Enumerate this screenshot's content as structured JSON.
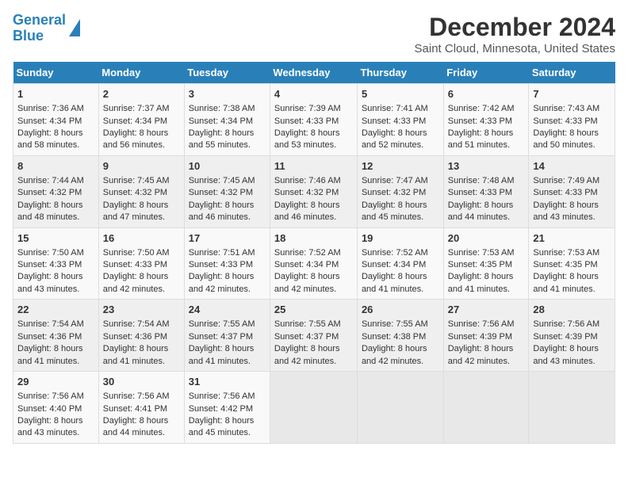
{
  "header": {
    "logo_line1": "General",
    "logo_line2": "Blue",
    "title": "December 2024",
    "subtitle": "Saint Cloud, Minnesota, United States"
  },
  "days_of_week": [
    "Sunday",
    "Monday",
    "Tuesday",
    "Wednesday",
    "Thursday",
    "Friday",
    "Saturday"
  ],
  "weeks": [
    [
      {
        "day": 1,
        "sunrise": "Sunrise: 7:36 AM",
        "sunset": "Sunset: 4:34 PM",
        "daylight": "Daylight: 8 hours and 58 minutes."
      },
      {
        "day": 2,
        "sunrise": "Sunrise: 7:37 AM",
        "sunset": "Sunset: 4:34 PM",
        "daylight": "Daylight: 8 hours and 56 minutes."
      },
      {
        "day": 3,
        "sunrise": "Sunrise: 7:38 AM",
        "sunset": "Sunset: 4:34 PM",
        "daylight": "Daylight: 8 hours and 55 minutes."
      },
      {
        "day": 4,
        "sunrise": "Sunrise: 7:39 AM",
        "sunset": "Sunset: 4:33 PM",
        "daylight": "Daylight: 8 hours and 53 minutes."
      },
      {
        "day": 5,
        "sunrise": "Sunrise: 7:41 AM",
        "sunset": "Sunset: 4:33 PM",
        "daylight": "Daylight: 8 hours and 52 minutes."
      },
      {
        "day": 6,
        "sunrise": "Sunrise: 7:42 AM",
        "sunset": "Sunset: 4:33 PM",
        "daylight": "Daylight: 8 hours and 51 minutes."
      },
      {
        "day": 7,
        "sunrise": "Sunrise: 7:43 AM",
        "sunset": "Sunset: 4:33 PM",
        "daylight": "Daylight: 8 hours and 50 minutes."
      }
    ],
    [
      {
        "day": 8,
        "sunrise": "Sunrise: 7:44 AM",
        "sunset": "Sunset: 4:32 PM",
        "daylight": "Daylight: 8 hours and 48 minutes."
      },
      {
        "day": 9,
        "sunrise": "Sunrise: 7:45 AM",
        "sunset": "Sunset: 4:32 PM",
        "daylight": "Daylight: 8 hours and 47 minutes."
      },
      {
        "day": 10,
        "sunrise": "Sunrise: 7:45 AM",
        "sunset": "Sunset: 4:32 PM",
        "daylight": "Daylight: 8 hours and 46 minutes."
      },
      {
        "day": 11,
        "sunrise": "Sunrise: 7:46 AM",
        "sunset": "Sunset: 4:32 PM",
        "daylight": "Daylight: 8 hours and 46 minutes."
      },
      {
        "day": 12,
        "sunrise": "Sunrise: 7:47 AM",
        "sunset": "Sunset: 4:32 PM",
        "daylight": "Daylight: 8 hours and 45 minutes."
      },
      {
        "day": 13,
        "sunrise": "Sunrise: 7:48 AM",
        "sunset": "Sunset: 4:33 PM",
        "daylight": "Daylight: 8 hours and 44 minutes."
      },
      {
        "day": 14,
        "sunrise": "Sunrise: 7:49 AM",
        "sunset": "Sunset: 4:33 PM",
        "daylight": "Daylight: 8 hours and 43 minutes."
      }
    ],
    [
      {
        "day": 15,
        "sunrise": "Sunrise: 7:50 AM",
        "sunset": "Sunset: 4:33 PM",
        "daylight": "Daylight: 8 hours and 43 minutes."
      },
      {
        "day": 16,
        "sunrise": "Sunrise: 7:50 AM",
        "sunset": "Sunset: 4:33 PM",
        "daylight": "Daylight: 8 hours and 42 minutes."
      },
      {
        "day": 17,
        "sunrise": "Sunrise: 7:51 AM",
        "sunset": "Sunset: 4:33 PM",
        "daylight": "Daylight: 8 hours and 42 minutes."
      },
      {
        "day": 18,
        "sunrise": "Sunrise: 7:52 AM",
        "sunset": "Sunset: 4:34 PM",
        "daylight": "Daylight: 8 hours and 42 minutes."
      },
      {
        "day": 19,
        "sunrise": "Sunrise: 7:52 AM",
        "sunset": "Sunset: 4:34 PM",
        "daylight": "Daylight: 8 hours and 41 minutes."
      },
      {
        "day": 20,
        "sunrise": "Sunrise: 7:53 AM",
        "sunset": "Sunset: 4:35 PM",
        "daylight": "Daylight: 8 hours and 41 minutes."
      },
      {
        "day": 21,
        "sunrise": "Sunrise: 7:53 AM",
        "sunset": "Sunset: 4:35 PM",
        "daylight": "Daylight: 8 hours and 41 minutes."
      }
    ],
    [
      {
        "day": 22,
        "sunrise": "Sunrise: 7:54 AM",
        "sunset": "Sunset: 4:36 PM",
        "daylight": "Daylight: 8 hours and 41 minutes."
      },
      {
        "day": 23,
        "sunrise": "Sunrise: 7:54 AM",
        "sunset": "Sunset: 4:36 PM",
        "daylight": "Daylight: 8 hours and 41 minutes."
      },
      {
        "day": 24,
        "sunrise": "Sunrise: 7:55 AM",
        "sunset": "Sunset: 4:37 PM",
        "daylight": "Daylight: 8 hours and 41 minutes."
      },
      {
        "day": 25,
        "sunrise": "Sunrise: 7:55 AM",
        "sunset": "Sunset: 4:37 PM",
        "daylight": "Daylight: 8 hours and 42 minutes."
      },
      {
        "day": 26,
        "sunrise": "Sunrise: 7:55 AM",
        "sunset": "Sunset: 4:38 PM",
        "daylight": "Daylight: 8 hours and 42 minutes."
      },
      {
        "day": 27,
        "sunrise": "Sunrise: 7:56 AM",
        "sunset": "Sunset: 4:39 PM",
        "daylight": "Daylight: 8 hours and 42 minutes."
      },
      {
        "day": 28,
        "sunrise": "Sunrise: 7:56 AM",
        "sunset": "Sunset: 4:39 PM",
        "daylight": "Daylight: 8 hours and 43 minutes."
      }
    ],
    [
      {
        "day": 29,
        "sunrise": "Sunrise: 7:56 AM",
        "sunset": "Sunset: 4:40 PM",
        "daylight": "Daylight: 8 hours and 43 minutes."
      },
      {
        "day": 30,
        "sunrise": "Sunrise: 7:56 AM",
        "sunset": "Sunset: 4:41 PM",
        "daylight": "Daylight: 8 hours and 44 minutes."
      },
      {
        "day": 31,
        "sunrise": "Sunrise: 7:56 AM",
        "sunset": "Sunset: 4:42 PM",
        "daylight": "Daylight: 8 hours and 45 minutes."
      },
      null,
      null,
      null,
      null
    ]
  ]
}
